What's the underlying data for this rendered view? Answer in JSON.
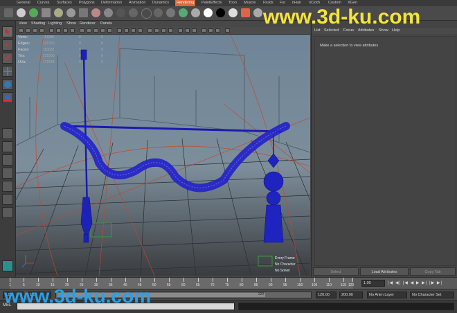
{
  "shelf": {
    "tabs": [
      "General",
      "Curves",
      "Surfaces",
      "Polygons",
      "Deformation",
      "Animation",
      "Dynamics",
      "Rendering",
      "PaintEffects",
      "Toon",
      "Muscle",
      "Fluids",
      "Fur",
      "nHair",
      "nCloth",
      "Custom",
      "XGen"
    ],
    "active_tab": "Rendering",
    "accent_color": "#d86a3a"
  },
  "panel": {
    "menus": [
      "View",
      "Shading",
      "Lighting",
      "Show",
      "Renderer",
      "Panels"
    ]
  },
  "hud": {
    "rows": [
      {
        "label": "Verts:",
        "value": "111686",
        "v2": "0",
        "v3": "0"
      },
      {
        "label": "Edges:",
        "value": "221760",
        "v2": "0",
        "v3": "0"
      },
      {
        "label": "Faces:",
        "value": "110032",
        "v2": "0",
        "v3": "0"
      },
      {
        "label": "Tris:",
        "value": "221000",
        "v2": "0",
        "v3": "0"
      },
      {
        "label": "UVs:",
        "value": "172944",
        "v2": "0",
        "v3": "0"
      }
    ],
    "footer": [
      "Every Frame",
      "No Character",
      "No Solver"
    ]
  },
  "attribute_editor": {
    "menus": [
      "List",
      "Selected",
      "Focus",
      "Attributes",
      "Show",
      "Help"
    ],
    "message": "Make a selection to view attributes",
    "buttons": {
      "select": "Select",
      "load": "Load Attributes",
      "copy": "Copy Tab"
    }
  },
  "time_slider": {
    "ticks": [
      "1",
      "5",
      "10",
      "15",
      "20",
      "25",
      "30",
      "35",
      "40",
      "45",
      "50",
      "55",
      "60",
      "65",
      "70",
      "75",
      "80",
      "85",
      "90",
      "95",
      "100",
      "105",
      "110",
      "115",
      "120"
    ],
    "current_frame": "1.00"
  },
  "range_slider": {
    "start": "1.00",
    "range_label": "120",
    "end": "120.00",
    "max": "200.00",
    "anim_layer": "No Anim Layer",
    "character_set": "No Character Set"
  },
  "command_line": {
    "label": "MEL"
  },
  "watermark": {
    "text": "www.3d-ku.com"
  }
}
